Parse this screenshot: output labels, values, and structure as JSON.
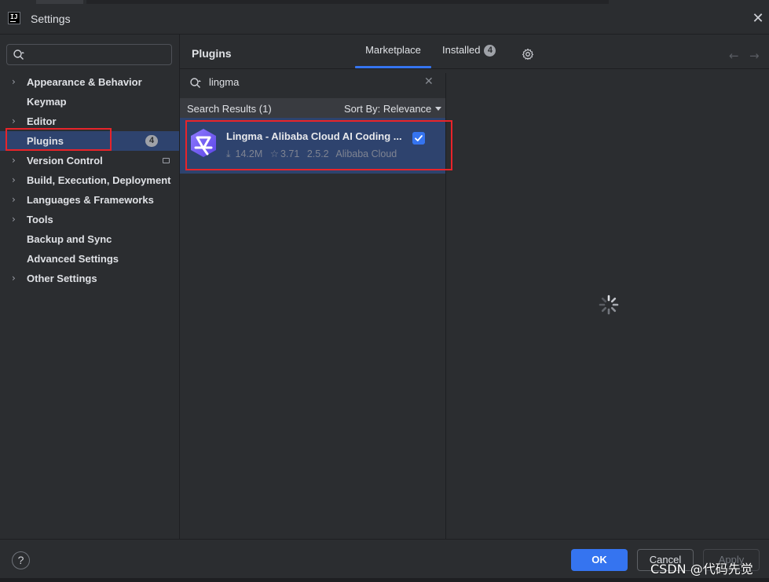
{
  "window": {
    "title": "Settings",
    "app_icon_text": "IJ"
  },
  "sidebar": {
    "search_placeholder": "",
    "items": [
      {
        "label": "Appearance & Behavior",
        "expandable": true
      },
      {
        "label": "Keymap",
        "expandable": false
      },
      {
        "label": "Editor",
        "expandable": true
      },
      {
        "label": "Plugins",
        "expandable": false,
        "selected": true,
        "badge": "4"
      },
      {
        "label": "Version Control",
        "expandable": true
      },
      {
        "label": "Build, Execution, Deployment",
        "expandable": true
      },
      {
        "label": "Languages & Frameworks",
        "expandable": true
      },
      {
        "label": "Tools",
        "expandable": true
      },
      {
        "label": "Backup and Sync",
        "expandable": false
      },
      {
        "label": "Advanced Settings",
        "expandable": false
      },
      {
        "label": "Other Settings",
        "expandable": true
      }
    ]
  },
  "header": {
    "title": "Plugins",
    "tabs": [
      {
        "label": "Marketplace",
        "active": true
      },
      {
        "label": "Installed",
        "badge": "4"
      }
    ]
  },
  "plugin_search": {
    "query": "lingma"
  },
  "results": {
    "label": "Search Results (1)",
    "sort_label": "Sort By: Relevance"
  },
  "plugin": {
    "name": "Lingma - Alibaba Cloud AI Coding ...",
    "downloads": "14.2M",
    "rating": "3.71",
    "version": "2.5.2",
    "vendor": "Alibaba Cloud",
    "installed": true
  },
  "footer": {
    "help": "?",
    "ok": "OK",
    "cancel": "Cancel",
    "apply": "Apply"
  },
  "watermark": "CSDN @代码先觉",
  "colors": {
    "accent": "#3574f0",
    "selection": "#2e436e",
    "highlight_box": "#e8242a",
    "background": "#2b2d30"
  },
  "icons": {
    "app": "intellij-icon",
    "close": "close-icon",
    "search": "search-icon",
    "settings": "gear-icon",
    "loading": "spinner-icon"
  }
}
